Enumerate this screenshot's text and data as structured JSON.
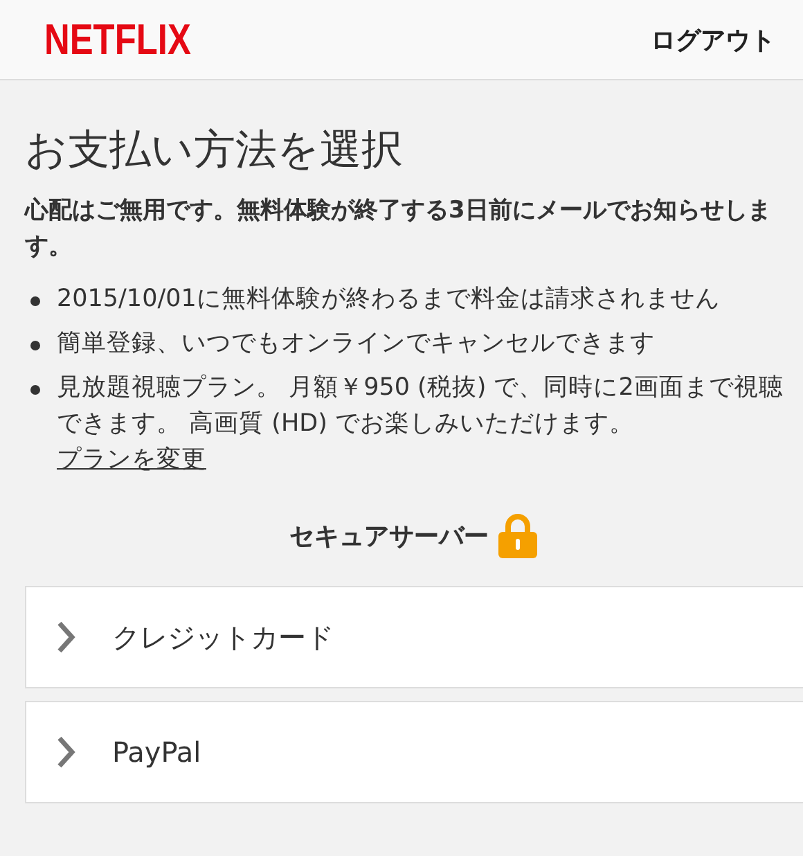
{
  "header": {
    "logo": "NETFLIX",
    "logout": "ログアウト"
  },
  "title": "お支払い方法を選択",
  "notice": "心配はご無用です。無料体験が終了する3日前にメールでお知らせします。",
  "bullets": [
    {
      "text": "2015/10/01に無料体験が終わるまで料金は請求されません"
    },
    {
      "text": "簡単登録、いつでもオンラインでキャンセルできます"
    },
    {
      "text": "見放題視聴プラン。 月額￥950 (税抜) で、同時に2画面まで視聴できます。 高画質 (HD) でお楽しみいただけます。",
      "link": "プランを変更"
    }
  ],
  "secure": "セキュアサーバー",
  "payment_options": [
    {
      "label": "クレジットカード"
    },
    {
      "label": "PayPal"
    }
  ]
}
